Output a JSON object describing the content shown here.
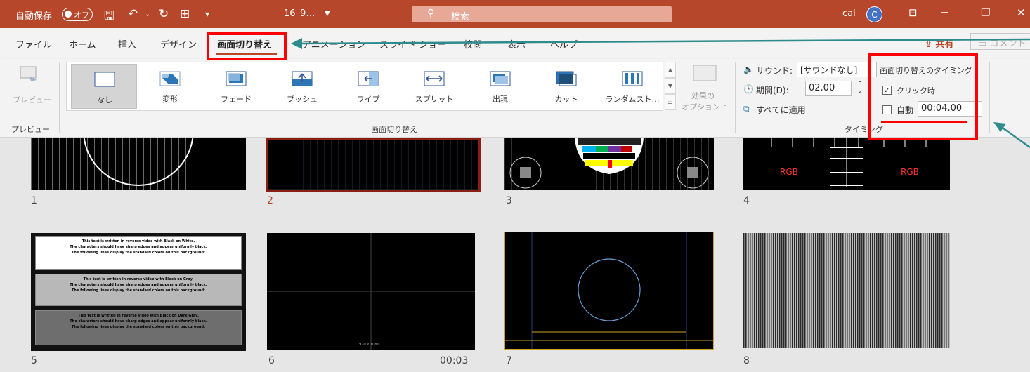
{
  "titlebar": {
    "autosave_label": "自動保存",
    "autosave_state": "オフ",
    "filename": "16_9…",
    "search_placeholder": "検索",
    "user": "cai",
    "avatar_initial": "C",
    "bg_color": "#b7472a"
  },
  "tabs": {
    "items": [
      "ファイル",
      "ホーム",
      "挿入",
      "デザイン",
      "画面切り替え",
      "アニメーション",
      "スライド ショー",
      "校閲",
      "表示",
      "ヘルプ"
    ],
    "active": "画面切り替え",
    "share": "共有",
    "comment": "コメント"
  },
  "ribbon": {
    "preview_label": "プレビュー",
    "preview_group": "プレビュー",
    "transitions": [
      "なし",
      "変形",
      "フェード",
      "プッシュ",
      "ワイプ",
      "スプリット",
      "出現",
      "カット",
      "ランダムスト…"
    ],
    "transitions_group": "画面切り替え",
    "effect_options": "効果の",
    "effect_options_2": "オプション",
    "sound_label": "サウンド:",
    "sound_value": "[サウンドなし]",
    "duration_label": "期間(D):",
    "duration_value": "02.00",
    "apply_all": "すべてに適用",
    "timing_title": "画面切り替えのタイミング",
    "on_click_label": "クリック時",
    "on_click_checked": true,
    "auto_label": "自動",
    "auto_checked": false,
    "auto_value": "00:04.00",
    "timing_group": "タイミング"
  },
  "slides": {
    "numbers": [
      "1",
      "2",
      "3",
      "4",
      "5",
      "6",
      "7",
      "8"
    ],
    "selected": "2",
    "slide4_text_left": "RGB",
    "slide4_text_right": "RGB",
    "slide6_time": "00:03",
    "slide6_caption": "1920 x 1080",
    "slide5_blocks": [
      {
        "line1": "This text is written in reverse video with Black on White.",
        "line2": "The characters should have sharp edges and appear uniformly black.",
        "line3": "The following lines display the standard colors on this background:"
      },
      {
        "line1": "This text is written in reverse video with Black on Gray.",
        "line2": "The characters should have sharp edges and appear uniformly black.",
        "line3": "The following lines display the standard colors on this background:"
      },
      {
        "line1": "This text is written in reverse video with Black on Dark Gray.",
        "line2": "The characters should have sharp edges and appear uniformly black.",
        "line3": "The following lines display the standard colors on this background:"
      }
    ]
  }
}
